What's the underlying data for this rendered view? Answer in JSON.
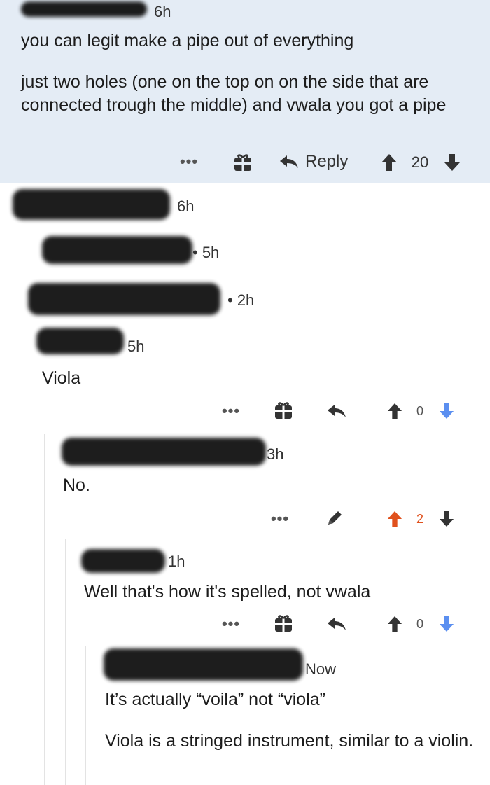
{
  "comments": [
    {
      "time": "6h",
      "paragraphs": [
        "you can legit make a pipe out of everything",
        "just two holes  (one on the top on on the side that are connected trough the middle) and vwala you got a pipe"
      ],
      "actions": {
        "more": "•••",
        "reply": "Reply",
        "score": "20"
      }
    },
    {
      "time": "6h"
    },
    {
      "time": "• 5h"
    },
    {
      "time": "• 2h"
    },
    {
      "time": "5h",
      "paragraphs": [
        "Viola"
      ],
      "actions": {
        "more": "•••",
        "score": "0"
      }
    },
    {
      "time": "3h",
      "paragraphs": [
        "No."
      ],
      "actions": {
        "more": "•••",
        "score": "2"
      }
    },
    {
      "time": "1h",
      "paragraphs": [
        "Well that's how it's spelled, not vwala"
      ],
      "actions": {
        "more": "•••",
        "score": "0"
      }
    },
    {
      "time": "Now",
      "paragraphs": [
        "It’s actually “voila” not “viola”",
        "Viola is a stringed instrument, similar to a violin."
      ]
    }
  ],
  "colors": {
    "highlight_bg": "#e4ecf5",
    "upvote_active": "#e0511d",
    "downvote": "#5b8ff0",
    "icon_dark": "#333333"
  }
}
